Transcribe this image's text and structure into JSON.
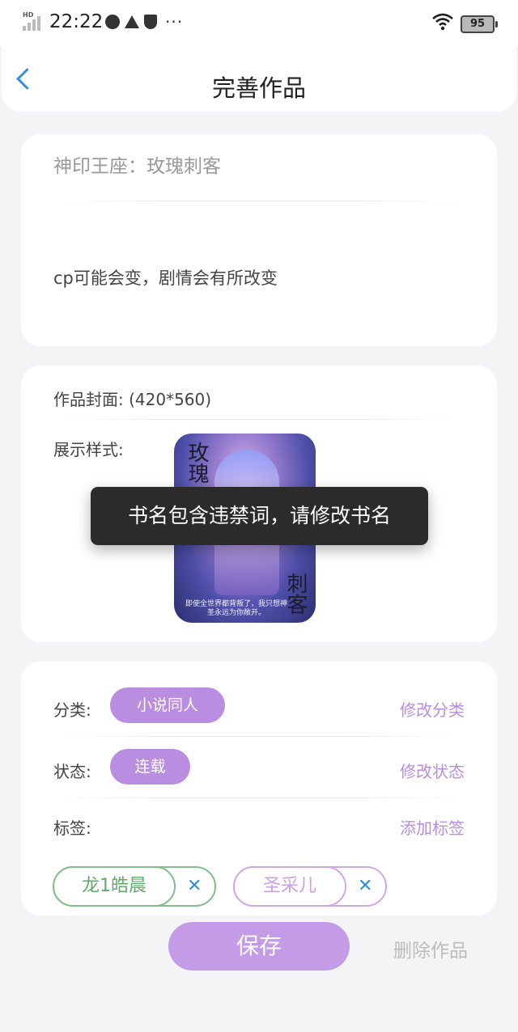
{
  "status_bar": {
    "time": "22:22",
    "signal_label": "HD",
    "battery": "95",
    "icons": [
      "signal-icon",
      "moon-icon",
      "crown-icon",
      "shield-icon",
      "more-dots-icon",
      "wifi-icon",
      "battery-icon"
    ]
  },
  "header": {
    "title": "完善作品",
    "back_icon": "chevron-left-icon"
  },
  "work": {
    "name": "神印王座：玫瑰刺客",
    "intro": "cp可能会变，剧情会有所改变"
  },
  "cover_section": {
    "cover_label": "作品封面: (420*560)",
    "display_label": "展示样式:",
    "cover_title_top": "玫瑰",
    "cover_title_bottom": "刺客",
    "cover_caption": "即使全世界都背叛了，我只想神圣永远为你敞开。"
  },
  "toast": {
    "message": "书名包含违禁词，请修改书名"
  },
  "details": {
    "category_label": "分类:",
    "category_value": "小说同人",
    "category_action": "修改分类",
    "status_label": "状态:",
    "status_value": "连载",
    "status_action": "修改状态",
    "tags_label": "标签:",
    "tags_action": "添加标签",
    "tags": [
      {
        "label": "龙1皓晨",
        "remove": "✕",
        "color": "#7cc08a"
      },
      {
        "label": "圣采儿",
        "remove": "✕",
        "color": "#cfa9e6"
      }
    ]
  },
  "footer": {
    "save_label": "保存",
    "delete_label": "删除作品"
  },
  "colors": {
    "accent_purple": "#b98ee0",
    "back_blue": "#2f8fe3",
    "toast_bg": "#2b2b2b"
  }
}
